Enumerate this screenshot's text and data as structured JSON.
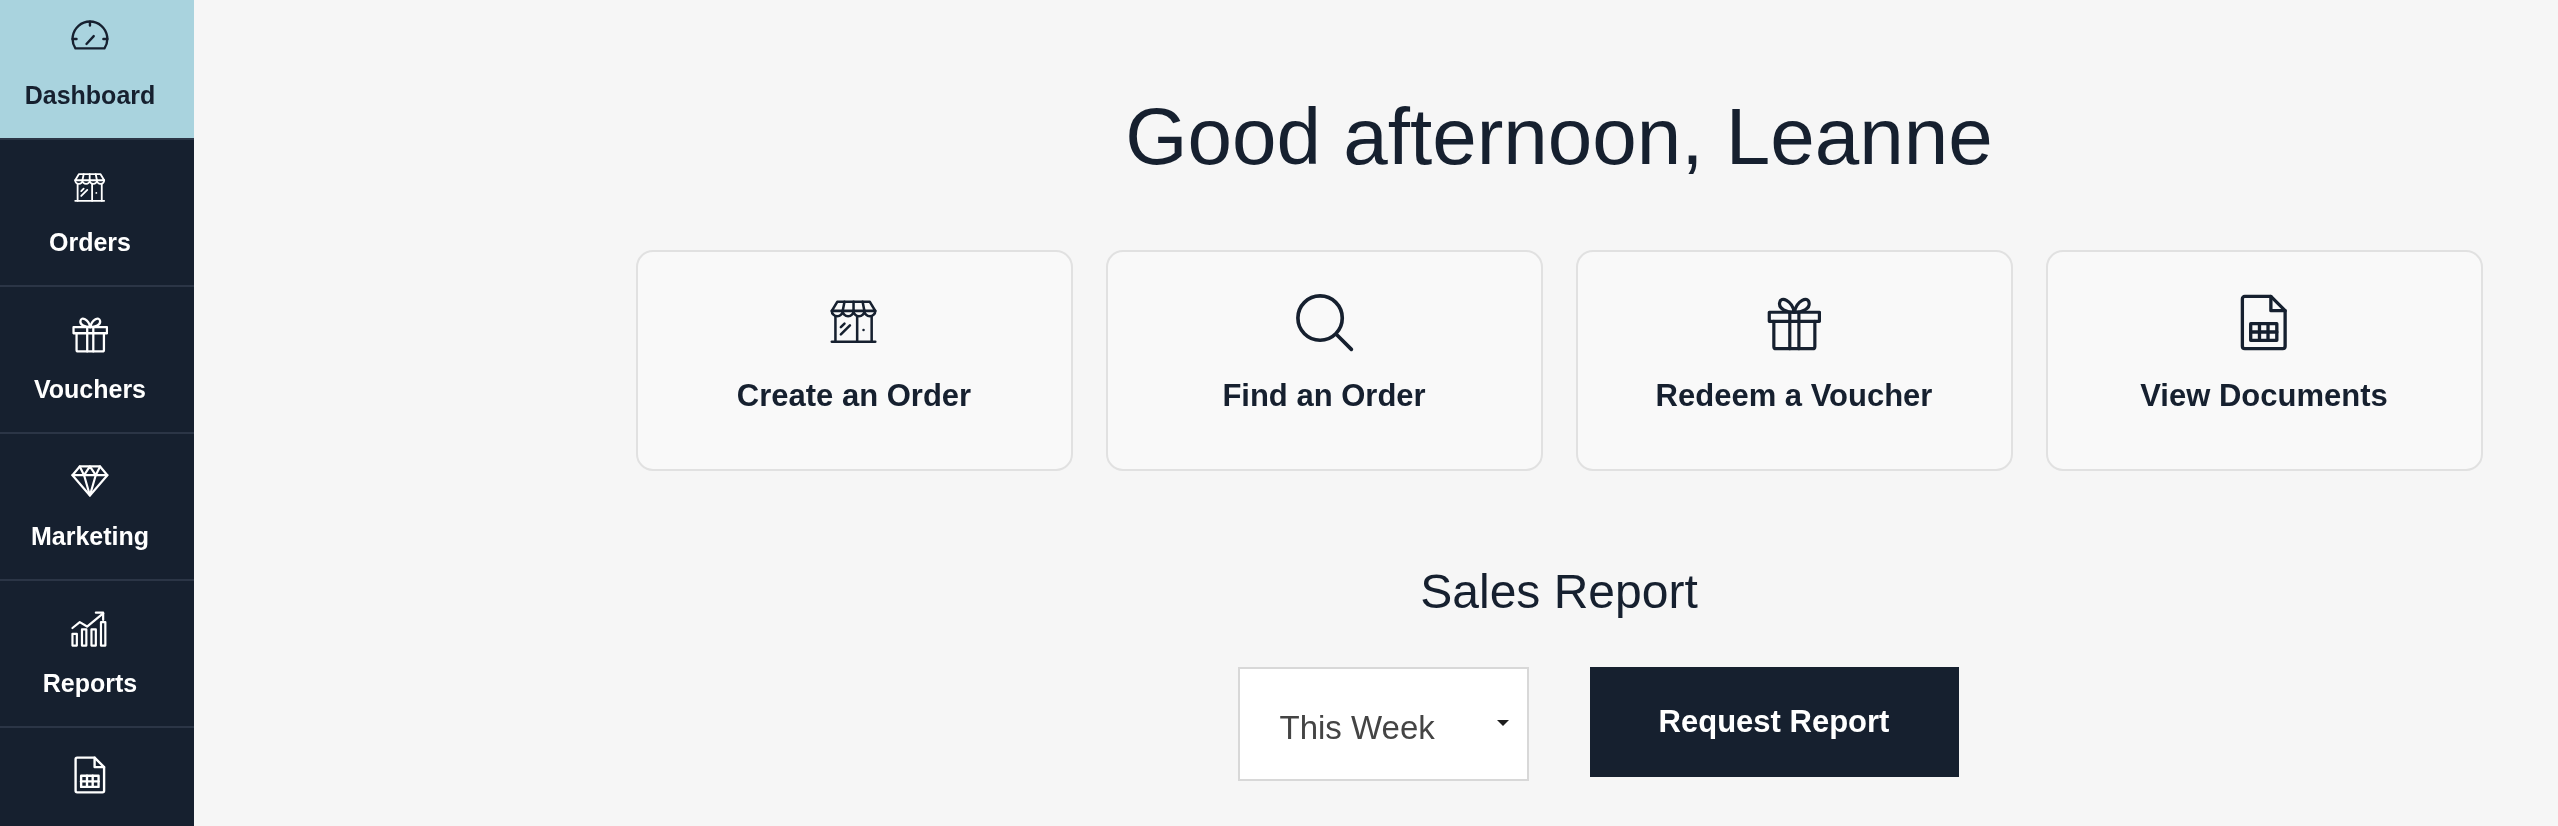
{
  "sidebar": {
    "items": [
      {
        "label": "Dashboard",
        "selected": true
      },
      {
        "label": "Orders",
        "selected": false
      },
      {
        "label": "Vouchers",
        "selected": false
      },
      {
        "label": "Marketing",
        "selected": false
      },
      {
        "label": "Reports",
        "selected": false
      },
      {
        "selected": false
      }
    ]
  },
  "main": {
    "greeting": "Good afternoon, Leanne",
    "quick_actions": [
      {
        "label": "Create an Order"
      },
      {
        "label": "Find an Order"
      },
      {
        "label": "Redeem a Voucher"
      },
      {
        "label": "View Documents"
      }
    ],
    "sales_report": {
      "title": "Sales Report",
      "period_select": {
        "value": "This Week"
      },
      "request_button": "Request Report"
    }
  }
}
